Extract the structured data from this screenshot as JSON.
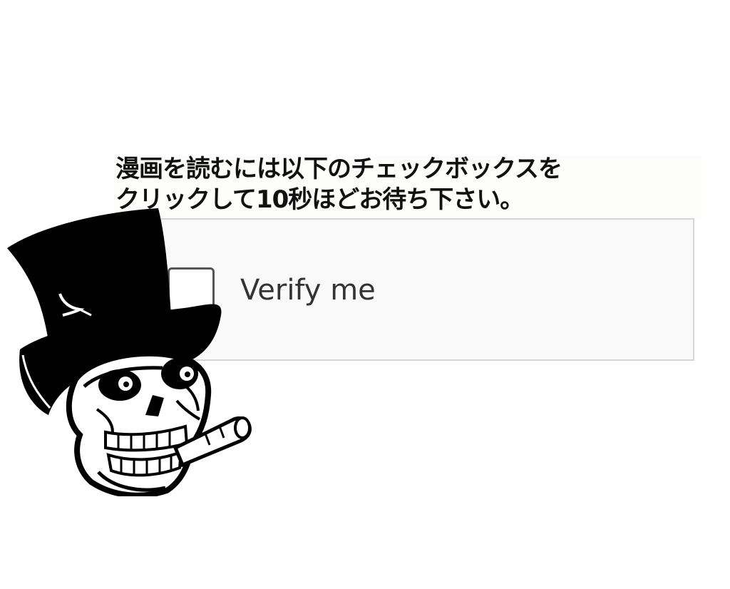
{
  "instruction": {
    "line1": "漫画を読むには以下のチェックボックスを",
    "line2": "クリックして10秒ほどお待ち下さい。"
  },
  "verify": {
    "label": "Verify me",
    "checked": false
  },
  "mascot": {
    "icon": "skull-top-hat-cigar-icon"
  },
  "colors": {
    "widget_background": "#f9f9f9",
    "widget_border": "#d6d6d6",
    "checkbox_border": "#555555",
    "text": "#111111"
  }
}
